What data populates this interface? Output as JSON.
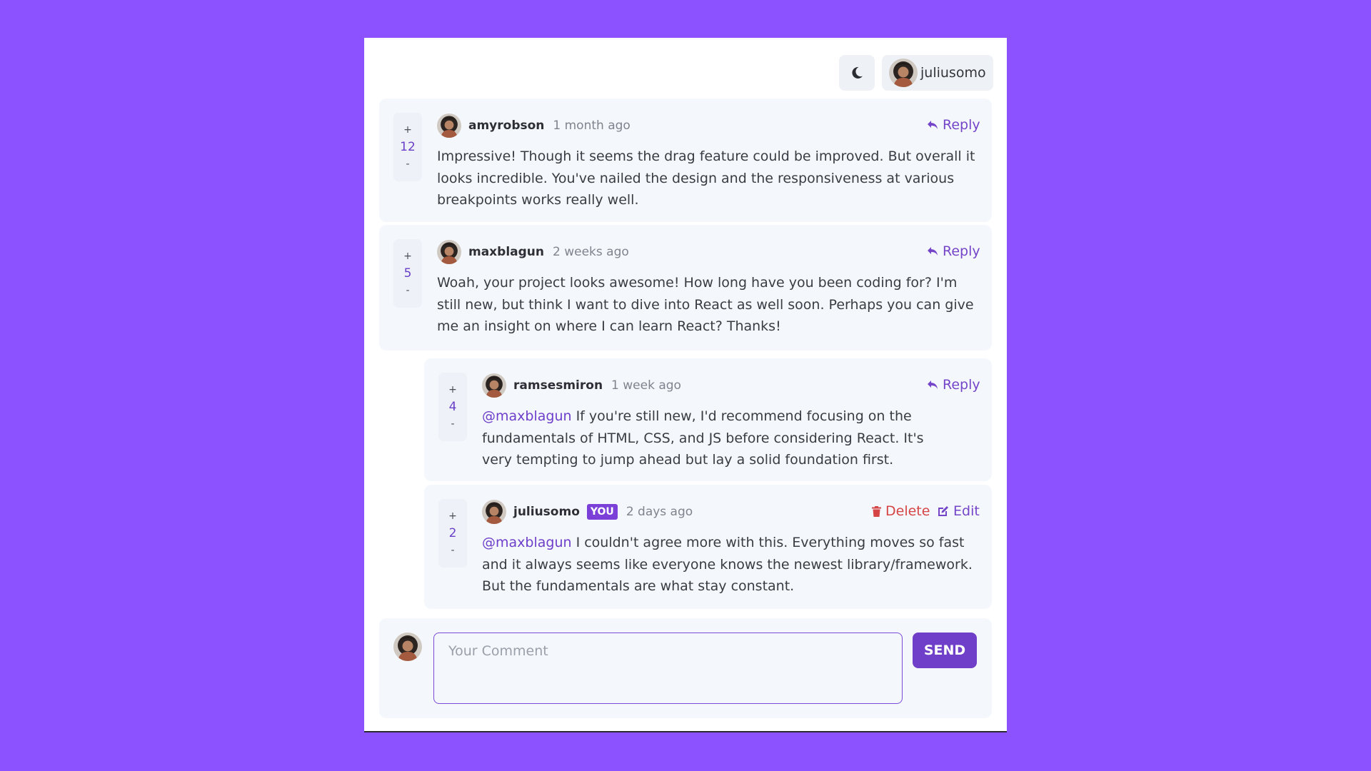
{
  "header": {
    "theme_toggle_icon": "moon-icon",
    "current_user": "juliusomo"
  },
  "comments": [
    {
      "username": "amyrobson",
      "time": "1 month ago",
      "score": "12",
      "upvote": "+",
      "downvote": "-",
      "action": "Reply",
      "content": "Impressive! Though it seems the drag feature could be improved. But overall it looks incredible. You've nailed the design and the responsiveness at various breakpoints works really well."
    },
    {
      "username": "maxblagun",
      "time": "2 weeks ago",
      "score": "5",
      "upvote": "+",
      "downvote": "-",
      "action": "Reply",
      "content": "Woah, your project looks awesome! How long have you been coding for? I'm still new, but think I want to dive into React as well soon. Perhaps you can give me an insight on where I can learn React? Thanks!"
    }
  ],
  "replies": [
    {
      "username": "ramsesmiron",
      "time": "1 week ago",
      "score": "4",
      "upvote": "+",
      "downvote": "-",
      "action": "Reply",
      "mention": "@maxblagun",
      "content": "If you're still new, I'd recommend focusing on the fundamentals of HTML, CSS, and JS before considering React. It's very tempting to jump ahead but lay a solid foundation first."
    },
    {
      "username": "juliusomo",
      "badge": "YOU",
      "time": "2 days ago",
      "score": "2",
      "upvote": "+",
      "downvote": "-",
      "delete_label": "Delete",
      "edit_label": "Edit",
      "mention": "@maxblagun",
      "content": "I couldn't agree more with this. Everything moves so fast and it always seems like everyone knows the newest library/framework. But the fundamentals are what stay constant."
    }
  ],
  "composer": {
    "placeholder": "Your Comment",
    "value": "",
    "send_label": "SEND"
  },
  "colors": {
    "background": "#8c52ff",
    "accent": "#6f3fc9",
    "danger": "#d64545"
  }
}
